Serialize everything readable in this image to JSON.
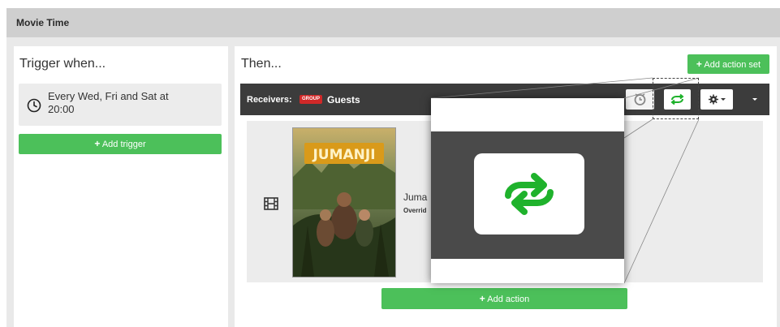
{
  "window": {
    "title": "Movie Time"
  },
  "trigger_panel": {
    "heading": "Trigger when...",
    "trigger": {
      "icon": "clock-icon",
      "text_line1": "Every Wed, Fri and Sat at",
      "text_line2": "20:00"
    },
    "add_trigger_label": "Add trigger"
  },
  "then_panel": {
    "heading": "Then...",
    "add_action_set_label": "Add action set",
    "receivers": {
      "label": "Receivers:",
      "badge": "GROUP",
      "group_name": "Guests"
    },
    "toolbar_icons": [
      "alarm-icon",
      "repeat-icon",
      "gear-icon",
      "caret-down-icon"
    ],
    "action": {
      "title": "Juma",
      "subtitle": "Overrid",
      "poster_title": "JUMANJI"
    },
    "add_action_label": "Add action"
  },
  "colors": {
    "green": "#4cc05a",
    "dark_bar": "#3c3c3c",
    "badge_red": "#d02828",
    "repeat_green": "#1fb22c"
  }
}
